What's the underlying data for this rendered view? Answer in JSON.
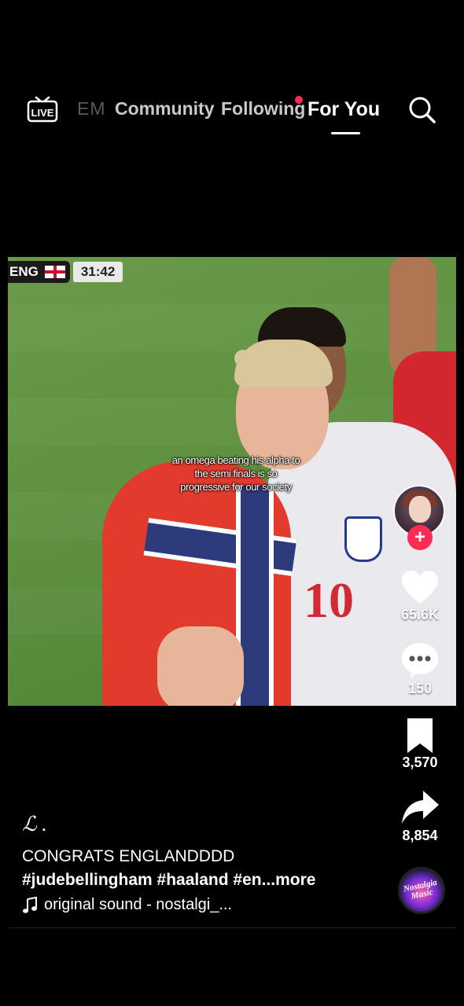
{
  "nav": {
    "live_label": "LIVE",
    "tabs": [
      {
        "label": "EM"
      },
      {
        "label": "Community"
      },
      {
        "label": "Following"
      },
      {
        "label": "For You"
      }
    ],
    "active_tab": "For You"
  },
  "video": {
    "scorebug_team": "ENG",
    "scorebug_time": "31:42",
    "shirt_number": "10",
    "caption": "an omega beating his alpha to the semi finals is so progressive for our society"
  },
  "rail": {
    "likes": "65.6K",
    "comments": "150",
    "saves": "3,570",
    "shares": "8,854",
    "follow_symbol": "+"
  },
  "post": {
    "username": "ℒ .",
    "description_line1": "CONGRATS ENGLANDDDD",
    "hashtags": "#judebellingham #haaland #en",
    "more_label": "...more",
    "sound": "original sound - nostalgi_...",
    "disc_label_1": "Nostalgia",
    "disc_label_2": "Music"
  },
  "colors": {
    "accent": "#fe2c55",
    "background": "#000000"
  },
  "icons": [
    "live-icon",
    "search-icon",
    "heart-icon",
    "comment-icon",
    "bookmark-icon",
    "share-icon",
    "music-note-icon"
  ]
}
